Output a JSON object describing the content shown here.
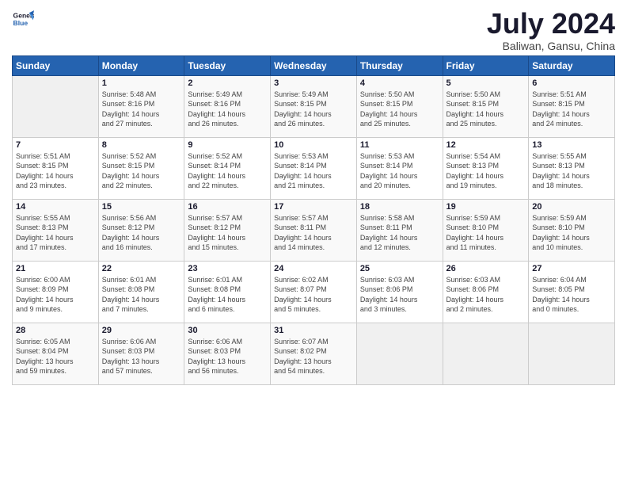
{
  "header": {
    "logo_line1": "General",
    "logo_line2": "Blue",
    "month_year": "July 2024",
    "location": "Baliwan, Gansu, China"
  },
  "days_of_week": [
    "Sunday",
    "Monday",
    "Tuesday",
    "Wednesday",
    "Thursday",
    "Friday",
    "Saturday"
  ],
  "weeks": [
    [
      {
        "num": "",
        "info": ""
      },
      {
        "num": "1",
        "info": "Sunrise: 5:48 AM\nSunset: 8:16 PM\nDaylight: 14 hours\nand 27 minutes."
      },
      {
        "num": "2",
        "info": "Sunrise: 5:49 AM\nSunset: 8:16 PM\nDaylight: 14 hours\nand 26 minutes."
      },
      {
        "num": "3",
        "info": "Sunrise: 5:49 AM\nSunset: 8:15 PM\nDaylight: 14 hours\nand 26 minutes."
      },
      {
        "num": "4",
        "info": "Sunrise: 5:50 AM\nSunset: 8:15 PM\nDaylight: 14 hours\nand 25 minutes."
      },
      {
        "num": "5",
        "info": "Sunrise: 5:50 AM\nSunset: 8:15 PM\nDaylight: 14 hours\nand 25 minutes."
      },
      {
        "num": "6",
        "info": "Sunrise: 5:51 AM\nSunset: 8:15 PM\nDaylight: 14 hours\nand 24 minutes."
      }
    ],
    [
      {
        "num": "7",
        "info": "Sunrise: 5:51 AM\nSunset: 8:15 PM\nDaylight: 14 hours\nand 23 minutes."
      },
      {
        "num": "8",
        "info": "Sunrise: 5:52 AM\nSunset: 8:15 PM\nDaylight: 14 hours\nand 22 minutes."
      },
      {
        "num": "9",
        "info": "Sunrise: 5:52 AM\nSunset: 8:14 PM\nDaylight: 14 hours\nand 22 minutes."
      },
      {
        "num": "10",
        "info": "Sunrise: 5:53 AM\nSunset: 8:14 PM\nDaylight: 14 hours\nand 21 minutes."
      },
      {
        "num": "11",
        "info": "Sunrise: 5:53 AM\nSunset: 8:14 PM\nDaylight: 14 hours\nand 20 minutes."
      },
      {
        "num": "12",
        "info": "Sunrise: 5:54 AM\nSunset: 8:13 PM\nDaylight: 14 hours\nand 19 minutes."
      },
      {
        "num": "13",
        "info": "Sunrise: 5:55 AM\nSunset: 8:13 PM\nDaylight: 14 hours\nand 18 minutes."
      }
    ],
    [
      {
        "num": "14",
        "info": "Sunrise: 5:55 AM\nSunset: 8:13 PM\nDaylight: 14 hours\nand 17 minutes."
      },
      {
        "num": "15",
        "info": "Sunrise: 5:56 AM\nSunset: 8:12 PM\nDaylight: 14 hours\nand 16 minutes."
      },
      {
        "num": "16",
        "info": "Sunrise: 5:57 AM\nSunset: 8:12 PM\nDaylight: 14 hours\nand 15 minutes."
      },
      {
        "num": "17",
        "info": "Sunrise: 5:57 AM\nSunset: 8:11 PM\nDaylight: 14 hours\nand 14 minutes."
      },
      {
        "num": "18",
        "info": "Sunrise: 5:58 AM\nSunset: 8:11 PM\nDaylight: 14 hours\nand 12 minutes."
      },
      {
        "num": "19",
        "info": "Sunrise: 5:59 AM\nSunset: 8:10 PM\nDaylight: 14 hours\nand 11 minutes."
      },
      {
        "num": "20",
        "info": "Sunrise: 5:59 AM\nSunset: 8:10 PM\nDaylight: 14 hours\nand 10 minutes."
      }
    ],
    [
      {
        "num": "21",
        "info": "Sunrise: 6:00 AM\nSunset: 8:09 PM\nDaylight: 14 hours\nand 9 minutes."
      },
      {
        "num": "22",
        "info": "Sunrise: 6:01 AM\nSunset: 8:08 PM\nDaylight: 14 hours\nand 7 minutes."
      },
      {
        "num": "23",
        "info": "Sunrise: 6:01 AM\nSunset: 8:08 PM\nDaylight: 14 hours\nand 6 minutes."
      },
      {
        "num": "24",
        "info": "Sunrise: 6:02 AM\nSunset: 8:07 PM\nDaylight: 14 hours\nand 5 minutes."
      },
      {
        "num": "25",
        "info": "Sunrise: 6:03 AM\nSunset: 8:06 PM\nDaylight: 14 hours\nand 3 minutes."
      },
      {
        "num": "26",
        "info": "Sunrise: 6:03 AM\nSunset: 8:06 PM\nDaylight: 14 hours\nand 2 minutes."
      },
      {
        "num": "27",
        "info": "Sunrise: 6:04 AM\nSunset: 8:05 PM\nDaylight: 14 hours\nand 0 minutes."
      }
    ],
    [
      {
        "num": "28",
        "info": "Sunrise: 6:05 AM\nSunset: 8:04 PM\nDaylight: 13 hours\nand 59 minutes."
      },
      {
        "num": "29",
        "info": "Sunrise: 6:06 AM\nSunset: 8:03 PM\nDaylight: 13 hours\nand 57 minutes."
      },
      {
        "num": "30",
        "info": "Sunrise: 6:06 AM\nSunset: 8:03 PM\nDaylight: 13 hours\nand 56 minutes."
      },
      {
        "num": "31",
        "info": "Sunrise: 6:07 AM\nSunset: 8:02 PM\nDaylight: 13 hours\nand 54 minutes."
      },
      {
        "num": "",
        "info": ""
      },
      {
        "num": "",
        "info": ""
      },
      {
        "num": "",
        "info": ""
      }
    ]
  ]
}
